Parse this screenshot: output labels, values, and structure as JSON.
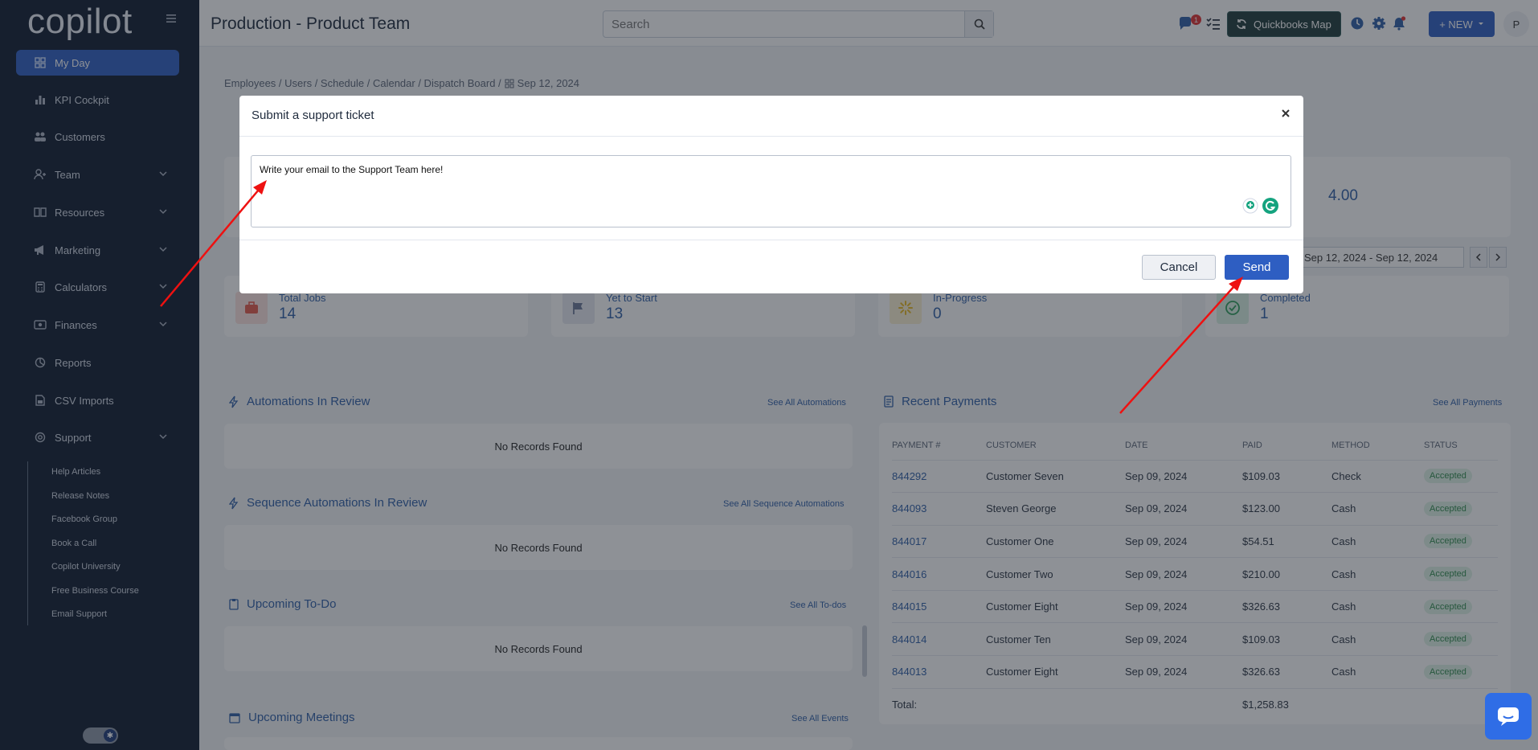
{
  "app": {
    "logo": "copilot"
  },
  "sidebar": {
    "items": [
      {
        "label": "My Day",
        "icon": "grid-icon"
      },
      {
        "label": "KPI Cockpit",
        "icon": "bar-chart-icon"
      },
      {
        "label": "Customers",
        "icon": "users-icon"
      },
      {
        "label": "Team",
        "icon": "team-icon"
      },
      {
        "label": "Resources",
        "icon": "book-icon"
      },
      {
        "label": "Marketing",
        "icon": "megaphone-icon"
      },
      {
        "label": "Calculators",
        "icon": "calculator-icon"
      },
      {
        "label": "Finances",
        "icon": "money-icon"
      },
      {
        "label": "Reports",
        "icon": "pie-chart-icon"
      },
      {
        "label": "CSV Imports",
        "icon": "file-icon"
      },
      {
        "label": "Support",
        "icon": "lifebuoy-icon"
      }
    ],
    "support_sub": [
      "Help Articles",
      "Release Notes",
      "Facebook Group",
      "Book a Call",
      "Copilot University",
      "Free Business Course",
      "Email Support"
    ]
  },
  "header": {
    "title": "Production - Product Team",
    "search_placeholder": "Search",
    "chat_badge": "1",
    "quickbooks_label": "Quickbooks Map",
    "new_label": "+ NEW",
    "avatar_initial": "P"
  },
  "breadcrumb": {
    "path": "Employees / Users / Schedule / Calendar / Dispatch Board /",
    "date": "Sep 12, 2024"
  },
  "partial_value": "4.00",
  "date_range": "Sep 12, 2024 - Sep 12, 2024",
  "stats": [
    {
      "label": "Total Jobs",
      "value": "14",
      "color": "#e55a4b"
    },
    {
      "label": "Yet to Start",
      "value": "13",
      "color": "#6a7796"
    },
    {
      "label": "In-Progress",
      "value": "0",
      "color": "#e8b923"
    },
    {
      "label": "Completed",
      "value": "1",
      "color": "#2f9e5c"
    }
  ],
  "sections": {
    "automations": {
      "title": "Automations In Review",
      "see_all": "See All Automations",
      "empty": "No Records Found"
    },
    "sequences": {
      "title": "Sequence Automations In Review",
      "see_all": "See All Sequence Automations",
      "empty": "No Records Found"
    },
    "todo": {
      "title": "Upcoming To-Do",
      "see_all": "See All To-dos",
      "empty": "No Records Found"
    },
    "meetings": {
      "title": "Upcoming Meetings",
      "see_all": "See All Events"
    }
  },
  "payments": {
    "title": "Recent Payments",
    "see_all": "See All Payments",
    "columns": [
      "PAYMENT #",
      "CUSTOMER",
      "DATE",
      "PAID",
      "METHOD",
      "STATUS"
    ],
    "rows": [
      [
        "844292",
        "Customer Seven",
        "Sep 09, 2024",
        "$109.03",
        "Check",
        "Accepted"
      ],
      [
        "844093",
        "Steven George",
        "Sep 09, 2024",
        "$123.00",
        "Cash",
        "Accepted"
      ],
      [
        "844017",
        "Customer One",
        "Sep 09, 2024",
        "$54.51",
        "Cash",
        "Accepted"
      ],
      [
        "844016",
        "Customer Two",
        "Sep 09, 2024",
        "$210.00",
        "Cash",
        "Accepted"
      ],
      [
        "844015",
        "Customer Eight",
        "Sep 09, 2024",
        "$326.63",
        "Cash",
        "Accepted"
      ],
      [
        "844014",
        "Customer Ten",
        "Sep 09, 2024",
        "$109.03",
        "Cash",
        "Accepted"
      ],
      [
        "844013",
        "Customer Eight",
        "Sep 09, 2024",
        "$326.63",
        "Cash",
        "Accepted"
      ]
    ],
    "total_label": "Total:",
    "total_value": "$1,258.83"
  },
  "modal": {
    "title": "Submit a support ticket",
    "textarea_value": "Write your email to the Support Team here!",
    "cancel_label": "Cancel",
    "send_label": "Send"
  },
  "colors": {
    "accent": "#2e5ec2",
    "sidebar_bg": "#0f1a2e",
    "annotation_arrow": "#ee1111"
  }
}
